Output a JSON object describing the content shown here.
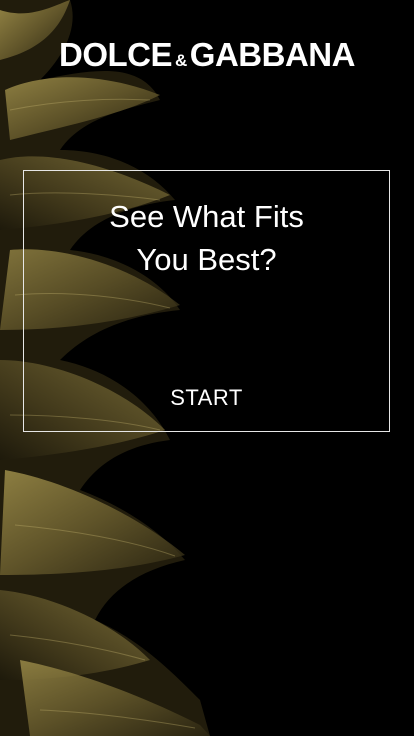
{
  "brand": {
    "left": "DOLCE",
    "amp": "&",
    "right": "GABBANA"
  },
  "card": {
    "line1": "See What Fits",
    "line2": "You Best?",
    "start_label": "START"
  },
  "colors": {
    "background": "#000000",
    "text": "#ffffff",
    "foliage_gold": "#8a7a3a",
    "foliage_dark": "#3a3218"
  }
}
